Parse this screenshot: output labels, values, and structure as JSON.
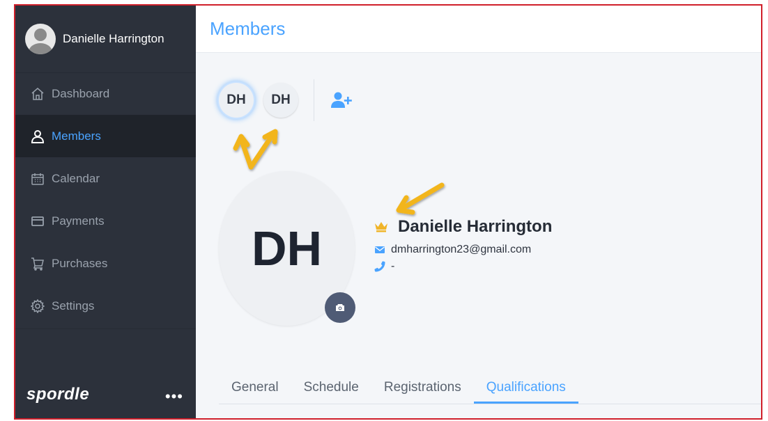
{
  "user": {
    "name": "Danielle Harrington"
  },
  "nav": [
    {
      "label": "Dashboard",
      "icon": "home-icon",
      "active": false
    },
    {
      "label": "Members",
      "icon": "user-icon",
      "active": true
    },
    {
      "label": "Calendar",
      "icon": "calendar-icon",
      "active": false
    },
    {
      "label": "Payments",
      "icon": "credit-card-icon",
      "active": false
    },
    {
      "label": "Purchases",
      "icon": "cart-icon",
      "active": false
    },
    {
      "label": "Settings",
      "icon": "gear-icon",
      "active": false
    }
  ],
  "brand": "spordle",
  "more": "•••",
  "page": {
    "title": "Members"
  },
  "member_chips": [
    "DH",
    "DH"
  ],
  "member": {
    "initials": "DH",
    "name": "Danielle Harrington",
    "email": "dmharrington23@gmail.com",
    "phone": "-"
  },
  "tabs": [
    {
      "label": "General",
      "active": false
    },
    {
      "label": "Schedule",
      "active": false
    },
    {
      "label": "Registrations",
      "active": false
    },
    {
      "label": "Qualifications",
      "active": true
    }
  ],
  "colors": {
    "accent": "#4aa3ff",
    "sidebar": "#2c313b",
    "crown": "#f0b429",
    "annotation": "#f2b51d",
    "frame": "#d01f2a"
  }
}
